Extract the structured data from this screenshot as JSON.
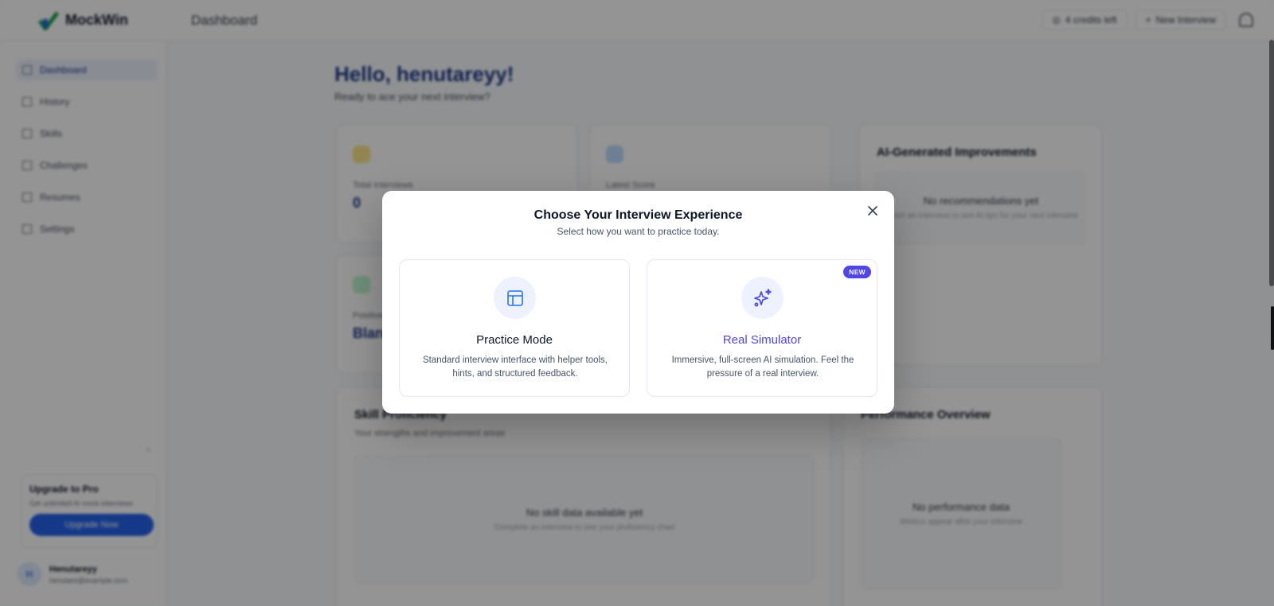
{
  "app": {
    "name": "MockWin",
    "page_title": "Dashboard",
    "credits_label": "4 credits left",
    "new_interview_label": "New Interview"
  },
  "sidebar": {
    "items": [
      {
        "label": "Dashboard",
        "icon": "grid-icon"
      },
      {
        "label": "History",
        "icon": "history-icon"
      },
      {
        "label": "Skills",
        "icon": "skills-icon"
      },
      {
        "label": "Challenges",
        "icon": "trophy-icon"
      },
      {
        "label": "Resumes",
        "icon": "file-icon"
      },
      {
        "label": "Settings",
        "icon": "gear-icon"
      }
    ],
    "upgrade": {
      "title": "Upgrade to Pro",
      "subtitle": "Get unlimited AI mock interviews",
      "button": "Upgrade Now"
    },
    "user": {
      "initial": "H",
      "name": "Henutareyy",
      "email": "henutare@example.com"
    }
  },
  "main": {
    "greeting": "Hello, henutareyy!",
    "greeting_sub": "Ready to ace your next interview?",
    "stats": [
      {
        "label": "Total Interviews",
        "value": "0"
      },
      {
        "label": "Latest Score",
        "value": ""
      },
      {
        "label": "Positive",
        "value": "Blank"
      }
    ],
    "improvements": {
      "title": "AI-Generated Improvements",
      "empty_title": "No recommendations yet",
      "empty_sub": "Finish an interview to see AI tips for your next interview"
    },
    "skills": {
      "title": "Skill Proficiency",
      "subtitle": "Your strengths and improvement areas",
      "empty_title": "No skill data available yet",
      "empty_sub": "Complete an interview to see your proficiency chart"
    },
    "performance": {
      "title": "Performance Overview",
      "empty_title": "No performance data",
      "empty_sub": "Metrics appear after your interview"
    }
  },
  "modal": {
    "title": "Choose Your Interview Experience",
    "subtitle": "Select how you want to practice today.",
    "options": [
      {
        "title": "Practice Mode",
        "description": "Standard interview interface with helper tools, hints, and structured feedback.",
        "icon": "layout-icon"
      },
      {
        "title": "Real Simulator",
        "description": "Immersive, full-screen AI simulation. Feel the pressure of a real interview.",
        "icon": "sparkles-icon",
        "badge": "NEW"
      }
    ]
  },
  "colors": {
    "accent": "#4f46e5",
    "primary_blue": "#2563eb",
    "icon_blue": "#3b82f6"
  }
}
